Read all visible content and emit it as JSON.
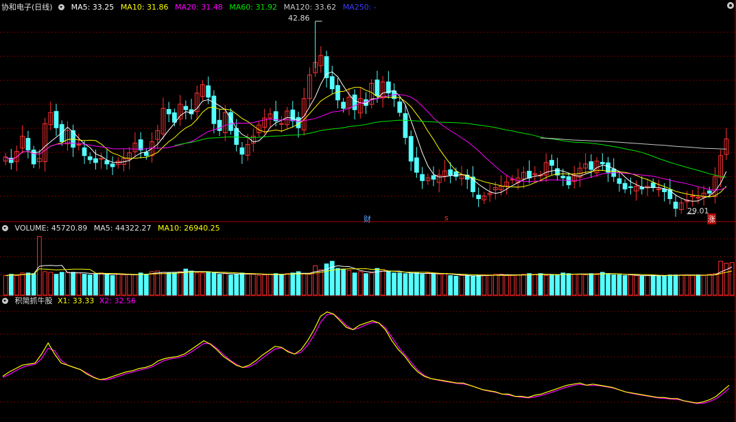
{
  "header": {
    "stock_name": "协和电子(日线)",
    "ma5": "MA5: 33.25",
    "ma10": "MA10: 31.86",
    "ma20": "MA20: 31.48",
    "ma60": "MA60: 31.92",
    "ma120": "MA120: 33.62",
    "ma250": "MA250: -"
  },
  "volume_header": {
    "volume": "VOLUME: 45720.89",
    "ma5": "MA5: 44322.27",
    "ma10": "MA10: 26940.25"
  },
  "indicator_header": {
    "name": "积简抓牛股",
    "x1": "X1: 33.33",
    "x2": "X2: 32.56"
  },
  "annotations": {
    "high_label": "42.86",
    "low_label": "29.01",
    "event_cai": "财",
    "event_s": "s",
    "event_zhang": "涨"
  },
  "colors": {
    "up": "#ff3232",
    "down": "#54ffff",
    "ma5": "#ffffff",
    "ma10": "#ffff00",
    "ma20": "#ff00ff",
    "ma60": "#00e600",
    "ma120": "#c8c8c8",
    "ma250": "#3c3cff",
    "grid": "#7a0000",
    "x1": "#ffff00",
    "x2": "#ff00ff"
  },
  "chart_data": [
    {
      "type": "candlestick",
      "series": [
        {
          "name": "MA5",
          "value": 33.25
        },
        {
          "name": "MA10",
          "value": 31.86
        },
        {
          "name": "MA20",
          "value": 31.48
        },
        {
          "name": "MA60",
          "value": 31.92
        },
        {
          "name": "MA120",
          "value": 33.62
        },
        {
          "name": "MA250",
          "value": null
        }
      ],
      "high": 42.86,
      "low": 29.01,
      "ylim": [
        28.5,
        43.5
      ],
      "closes": [
        33.1,
        32.7,
        33.5,
        34.6,
        33.6,
        32.6,
        33.0,
        35.5,
        36.3,
        35.2,
        34.2,
        35.0,
        33.8,
        34.0,
        33.2,
        32.9,
        32.7,
        33.0,
        32.6,
        32.4,
        32.8,
        33.0,
        33.4,
        34.1,
        33.6,
        33.2,
        34.2,
        35.0,
        36.6,
        36.2,
        35.6,
        36.9,
        36.5,
        36.2,
        37.7,
        38.3,
        37.4,
        35.5,
        35.0,
        36.3,
        35.0,
        34.0,
        33.3,
        34.0,
        34.6,
        35.4,
        35.9,
        36.2,
        35.7,
        35.5,
        36.4,
        35.7,
        35.2,
        37.3,
        39.0,
        39.9,
        40.4,
        38.8,
        38.0,
        37.2,
        36.6,
        37.4,
        36.5,
        37.3,
        36.8,
        38.4,
        37.5,
        38.5,
        37.7,
        37.3,
        36.3,
        34.5,
        32.8,
        32.0,
        31.4,
        31.6,
        31.5,
        31.8,
        32.1,
        31.8,
        31.7,
        31.8,
        31.5,
        30.6,
        30.1,
        30.3,
        30.5,
        30.9,
        31.0,
        31.3,
        31.5,
        31.6,
        32.0,
        31.6,
        31.9,
        31.8,
        32.7,
        32.5,
        31.8,
        31.6,
        31.1,
        31.8,
        32.3,
        32.6,
        32.2,
        32.8,
        32.6,
        32.0,
        31.7,
        31.2,
        30.8,
        30.9,
        31.0,
        30.8,
        31.0,
        30.9,
        30.8,
        30.6,
        30.1,
        29.4,
        29.8,
        30.0,
        30.3,
        30.2,
        30.5,
        30.5,
        31.7,
        33.2,
        34.4
      ]
    },
    {
      "type": "bar",
      "series": [
        {
          "name": "VOLUME",
          "value": 45720.89
        },
        {
          "name": "MA5",
          "value": 44322.27
        },
        {
          "name": "MA10",
          "value": 26940.25
        }
      ],
      "values": [
        30,
        32,
        30,
        34,
        34,
        33,
        90,
        36,
        35,
        32,
        35,
        35,
        35,
        34,
        32,
        31,
        32,
        34,
        33,
        30,
        32,
        31,
        32,
        31,
        34,
        32,
        36,
        37,
        35,
        34,
        34,
        36,
        40,
        37,
        34,
        34,
        35,
        34,
        32,
        33,
        31,
        32,
        34,
        33,
        32,
        30,
        31,
        32,
        33,
        32,
        33,
        34,
        36,
        33,
        32,
        45,
        39,
        48,
        52,
        41,
        40,
        38,
        34,
        36,
        33,
        34,
        41,
        39,
        36,
        34,
        34,
        33,
        33,
        34,
        32,
        34,
        33,
        32,
        33,
        30,
        29,
        30,
        30,
        29,
        30,
        31,
        31,
        32,
        32,
        30,
        30,
        31,
        32,
        33,
        32,
        33,
        30,
        31,
        31,
        34,
        33,
        32,
        32,
        31,
        33,
        33,
        35,
        33,
        31,
        31,
        30,
        31,
        30,
        29,
        30,
        30,
        30,
        30,
        31,
        31,
        31,
        31,
        30,
        31,
        30,
        32,
        33,
        52,
        49,
        50
      ]
    },
    {
      "type": "line",
      "series": [
        {
          "name": "X1",
          "value": 33.33
        },
        {
          "name": "X2",
          "value": 32.56
        }
      ],
      "x1": [
        38,
        42,
        45,
        48,
        49,
        50,
        58,
        68,
        58,
        50,
        48,
        46,
        44,
        40,
        37,
        35,
        36,
        38,
        40,
        42,
        43,
        45,
        46,
        48,
        52,
        54,
        55,
        56,
        58,
        62,
        66,
        70,
        67,
        62,
        56,
        52,
        48,
        46,
        48,
        52,
        57,
        61,
        65,
        64,
        60,
        58,
        62,
        70,
        80,
        92,
        96,
        94,
        88,
        82,
        80,
        84,
        86,
        88,
        86,
        80,
        70,
        62,
        56,
        48,
        42,
        38,
        36,
        35,
        34,
        33,
        32,
        32,
        30,
        28,
        26,
        25,
        24,
        22,
        22,
        20,
        20,
        19,
        21,
        22,
        24,
        26,
        28,
        30,
        31,
        32,
        30,
        31,
        30,
        29,
        28,
        26,
        24,
        23,
        22,
        21,
        20,
        19,
        19,
        18,
        18,
        16,
        15,
        14,
        15,
        17,
        20,
        25,
        30
      ]
    },
    {
      "type": "table",
      "title": "indicator_x1_x2_last",
      "x1": 33.33,
      "x2": 32.56
    }
  ]
}
